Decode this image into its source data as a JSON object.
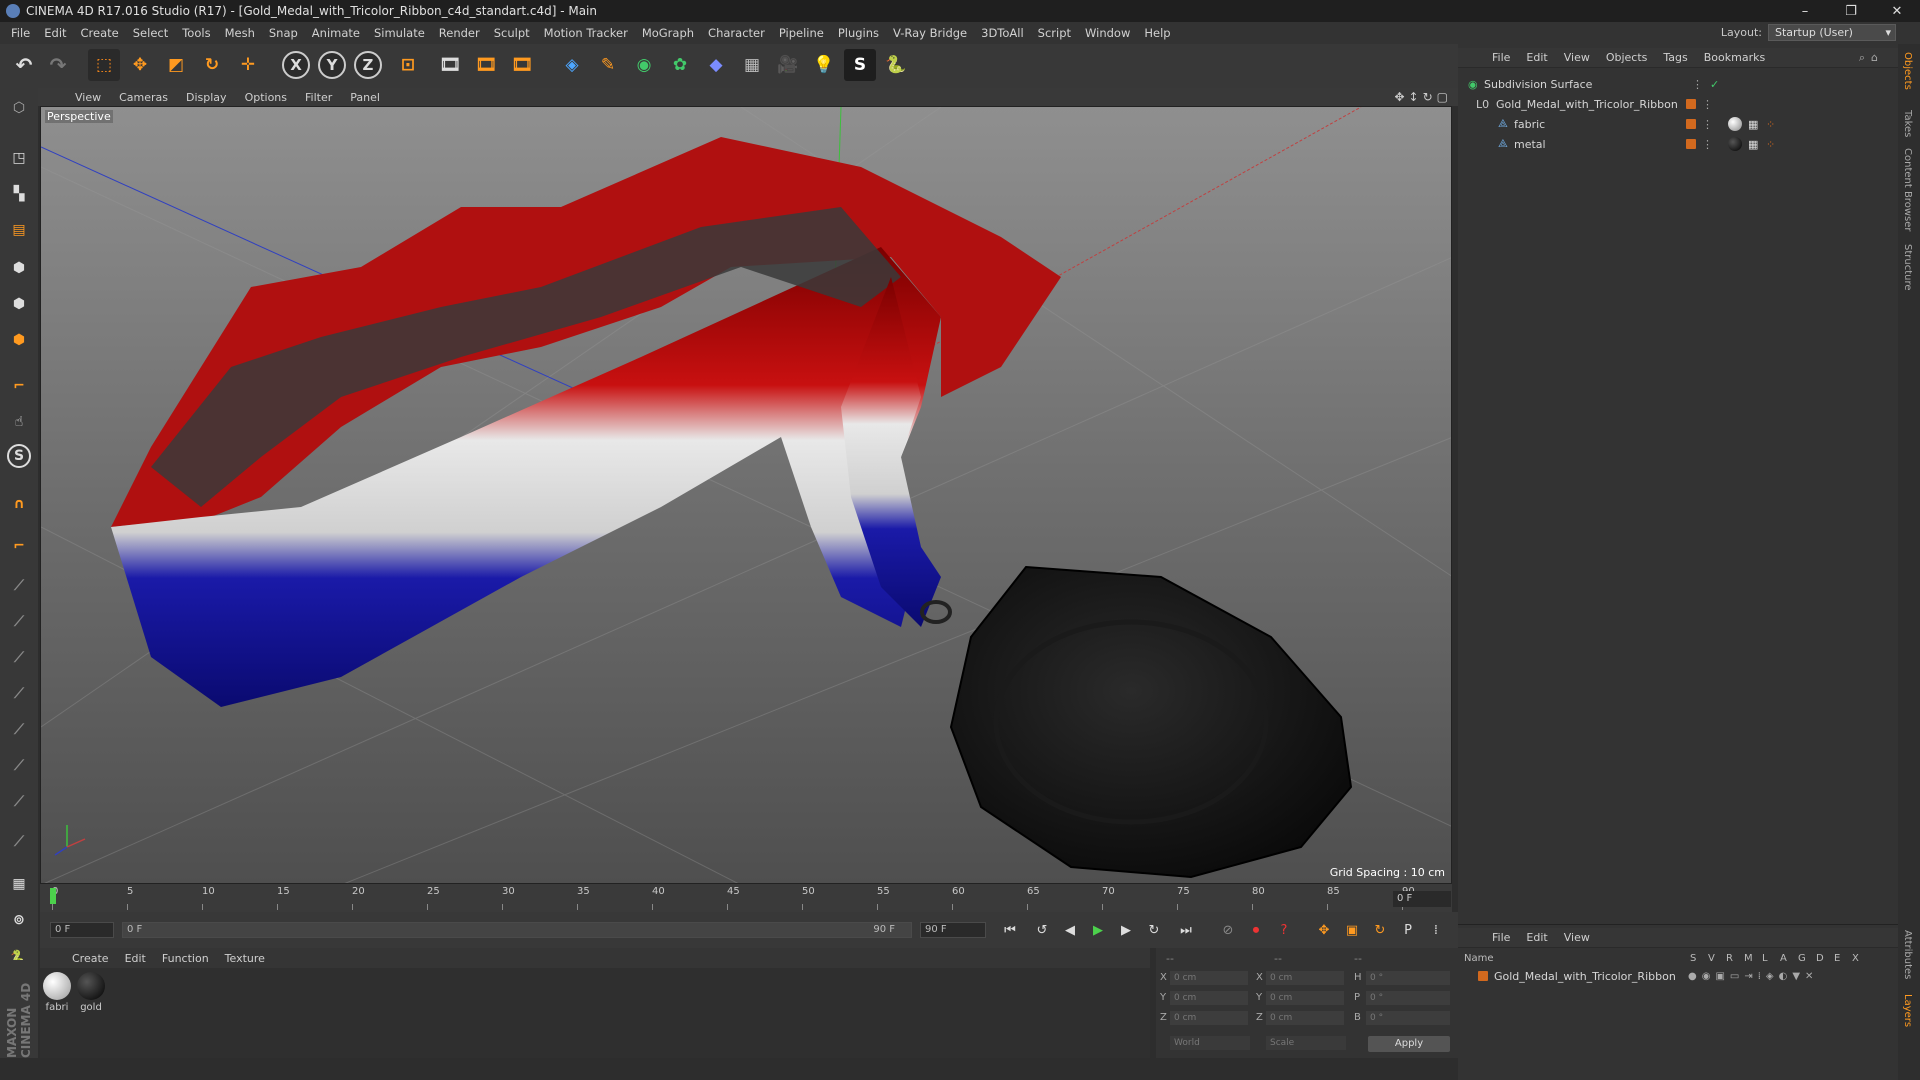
{
  "window": {
    "title": "CINEMA 4D R17.016 Studio (R17) - [Gold_Medal_with_Tricolor_Ribbon_c4d_standart.c4d] - Main",
    "controls": [
      "–",
      "❐",
      "✕"
    ]
  },
  "menubar": {
    "items": [
      "File",
      "Edit",
      "Create",
      "Select",
      "Tools",
      "Mesh",
      "Snap",
      "Animate",
      "Simulate",
      "Render",
      "Sculpt",
      "Motion Tracker",
      "MoGraph",
      "Character",
      "Pipeline",
      "Plugins",
      "V-Ray Bridge",
      "3DToAll",
      "Script",
      "Window",
      "Help"
    ],
    "layout_label": "Layout:",
    "layout_value": "Startup (User)"
  },
  "toolbar": {
    "x_label": "X",
    "y_label": "Y",
    "z_label": "Z"
  },
  "viewport": {
    "menu": [
      "View",
      "Cameras",
      "Display",
      "Options",
      "Filter",
      "Panel"
    ],
    "label": "Perspective",
    "grid_spacing": "Grid Spacing : 10 cm"
  },
  "timeline": {
    "ticks": [
      "0",
      "5",
      "10",
      "15",
      "20",
      "25",
      "30",
      "35",
      "40",
      "45",
      "50",
      "55",
      "60",
      "65",
      "70",
      "75",
      "80",
      "85",
      "90"
    ],
    "current_frame": "0 F"
  },
  "transport": {
    "start_field": "0 F",
    "range_start": "0 F",
    "range_end": "90 F",
    "end_field": "90 F"
  },
  "materials": {
    "menu": [
      "Create",
      "Edit",
      "Function",
      "Texture"
    ],
    "items": [
      {
        "label": "fabri",
        "color": "#e8e8e8"
      },
      {
        "label": "gold",
        "color": "#1a1a1a"
      }
    ]
  },
  "coords": {
    "header1": "--",
    "header2": "--",
    "header3": "--",
    "rows": [
      {
        "axis": "X",
        "pos": "0 cm",
        "size_axis": "X",
        "size": "0 cm",
        "rot_axis": "H",
        "rot": "0 °"
      },
      {
        "axis": "Y",
        "pos": "0 cm",
        "size_axis": "Y",
        "size": "0 cm",
        "rot_axis": "P",
        "rot": "0 °"
      },
      {
        "axis": "Z",
        "pos": "0 cm",
        "size_axis": "Z",
        "size": "0 cm",
        "rot_axis": "B",
        "rot": "0 °"
      }
    ],
    "world": "World",
    "scale": "Scale",
    "apply": "Apply"
  },
  "objects_panel": {
    "menu": [
      "File",
      "Edit",
      "View",
      "Objects",
      "Tags",
      "Bookmarks"
    ],
    "rows": [
      {
        "name": "Subdivision Surface"
      },
      {
        "name": "Gold_Medal_with_Tricolor_Ribbon"
      },
      {
        "name": "fabric"
      },
      {
        "name": "metal"
      }
    ]
  },
  "layers_panel": {
    "menu": [
      "File",
      "Edit",
      "View"
    ],
    "columns": [
      "Name",
      "S",
      "V",
      "R",
      "M",
      "L",
      "A",
      "G",
      "D",
      "E",
      "X"
    ],
    "row": "Gold_Medal_with_Tricolor_Ribbon"
  },
  "sidetabs": [
    "Objects",
    "Takes",
    "Content Browser",
    "Structure",
    "Attributes",
    "Layers"
  ],
  "brand": "MAXON CINEMA 4D"
}
